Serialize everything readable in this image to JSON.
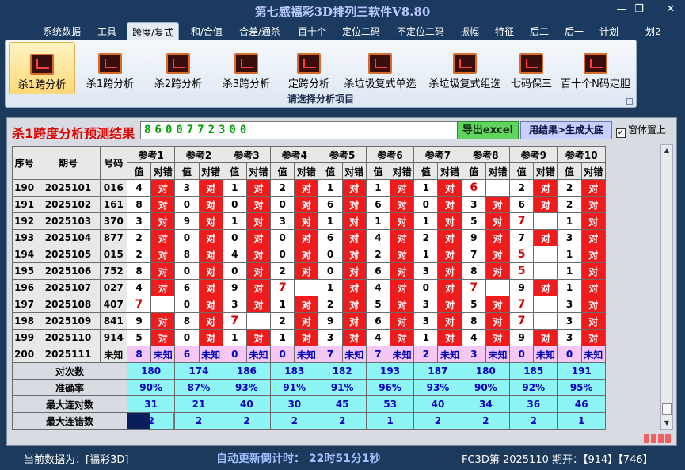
{
  "window": {
    "title": "第七感福彩3D排列三软件V8.80",
    "minimize": "—",
    "restore": "❐",
    "close": "✕"
  },
  "menu": [
    "系统数据",
    "工具",
    "跨度/复式",
    "和/合值",
    "合差/通杀",
    "百十个",
    "定位二码",
    "不定位二码",
    "振幅",
    "特征",
    "后二",
    "后一",
    "计划",
    "划2"
  ],
  "menu_active_index": 2,
  "ribbon": {
    "buttons": [
      "杀1跨分析",
      "杀1跨分析",
      "杀2跨分析",
      "杀3跨分析",
      "定跨分析",
      "杀垃圾复式单选",
      "杀垃圾复式组选",
      "七码保三",
      "百十个N码定胆"
    ],
    "selected_index": 0,
    "group_label": "请选择分析项目"
  },
  "result": {
    "label": "杀1跨度分析预测结果",
    "value": "8600772300",
    "excel_button": "导出excel",
    "generate_button": "用结果>生成大底",
    "pin_label": "窗体置上",
    "pin_checked": true
  },
  "table": {
    "col_no": "序号",
    "col_period": "期号",
    "col_code": "号码",
    "refs": [
      "参考1",
      "参考2",
      "参考3",
      "参考4",
      "参考5",
      "参考6",
      "参考7",
      "参考8",
      "参考9",
      "参考10"
    ],
    "sub_value": "值",
    "sub_result": "对错",
    "ok_text": "对",
    "rows": [
      {
        "no": "190",
        "period": "2025101",
        "code": "016",
        "cells": [
          [
            "4",
            "对"
          ],
          [
            "3",
            "对"
          ],
          [
            "1",
            "对"
          ],
          [
            "2",
            "对"
          ],
          [
            "1",
            "对"
          ],
          [
            "1",
            "对"
          ],
          [
            "1",
            "对"
          ],
          [
            "6",
            ""
          ],
          [
            "2",
            "对"
          ],
          [
            "2",
            "对"
          ]
        ],
        "hl": [
          7
        ]
      },
      {
        "no": "191",
        "period": "2025102",
        "code": "161",
        "cells": [
          [
            "8",
            "对"
          ],
          [
            "0",
            "对"
          ],
          [
            "0",
            "对"
          ],
          [
            "0",
            "对"
          ],
          [
            "6",
            "对"
          ],
          [
            "6",
            "对"
          ],
          [
            "0",
            "对"
          ],
          [
            "3",
            "对"
          ],
          [
            "6",
            "对"
          ],
          [
            "2",
            "对"
          ]
        ],
        "hl": []
      },
      {
        "no": "192",
        "period": "2025103",
        "code": "370",
        "cells": [
          [
            "3",
            "对"
          ],
          [
            "9",
            "对"
          ],
          [
            "1",
            "对"
          ],
          [
            "3",
            "对"
          ],
          [
            "1",
            "对"
          ],
          [
            "1",
            "对"
          ],
          [
            "1",
            "对"
          ],
          [
            "5",
            "对"
          ],
          [
            "7",
            ""
          ],
          [
            "1",
            "对"
          ]
        ],
        "hl": [
          8
        ]
      },
      {
        "no": "193",
        "period": "2025104",
        "code": "877",
        "cells": [
          [
            "2",
            "对"
          ],
          [
            "0",
            "对"
          ],
          [
            "0",
            "对"
          ],
          [
            "0",
            "对"
          ],
          [
            "6",
            "对"
          ],
          [
            "4",
            "对"
          ],
          [
            "2",
            "对"
          ],
          [
            "9",
            "对"
          ],
          [
            "7",
            "对"
          ],
          [
            "3",
            "对"
          ]
        ],
        "hl": []
      },
      {
        "no": "194",
        "period": "2025105",
        "code": "015",
        "cells": [
          [
            "2",
            "对"
          ],
          [
            "8",
            "对"
          ],
          [
            "4",
            "对"
          ],
          [
            "0",
            "对"
          ],
          [
            "0",
            "对"
          ],
          [
            "2",
            "对"
          ],
          [
            "1",
            "对"
          ],
          [
            "7",
            "对"
          ],
          [
            "5",
            ""
          ],
          [
            "1",
            "对"
          ]
        ],
        "hl": [
          8
        ]
      },
      {
        "no": "195",
        "period": "2025106",
        "code": "752",
        "cells": [
          [
            "8",
            "对"
          ],
          [
            "0",
            "对"
          ],
          [
            "0",
            "对"
          ],
          [
            "2",
            "对"
          ],
          [
            "0",
            "对"
          ],
          [
            "6",
            "对"
          ],
          [
            "3",
            "对"
          ],
          [
            "8",
            "对"
          ],
          [
            "5",
            ""
          ],
          [
            "1",
            "对"
          ]
        ],
        "hl": [
          8
        ]
      },
      {
        "no": "196",
        "period": "2025107",
        "code": "027",
        "cells": [
          [
            "4",
            "对"
          ],
          [
            "6",
            "对"
          ],
          [
            "9",
            "对"
          ],
          [
            "7",
            ""
          ],
          [
            "1",
            "对"
          ],
          [
            "4",
            "对"
          ],
          [
            "0",
            "对"
          ],
          [
            "7",
            ""
          ],
          [
            "9",
            "对"
          ],
          [
            "1",
            "对"
          ]
        ],
        "hl": [
          3,
          7
        ]
      },
      {
        "no": "197",
        "period": "2025108",
        "code": "407",
        "cells": [
          [
            "7",
            ""
          ],
          [
            "0",
            "对"
          ],
          [
            "3",
            "对"
          ],
          [
            "1",
            "对"
          ],
          [
            "2",
            "对"
          ],
          [
            "5",
            "对"
          ],
          [
            "3",
            "对"
          ],
          [
            "5",
            "对"
          ],
          [
            "7",
            ""
          ],
          [
            "3",
            "对"
          ]
        ],
        "hl": [
          0,
          8
        ]
      },
      {
        "no": "198",
        "period": "2025109",
        "code": "841",
        "cells": [
          [
            "9",
            "对"
          ],
          [
            "8",
            "对"
          ],
          [
            "7",
            ""
          ],
          [
            "2",
            "对"
          ],
          [
            "9",
            "对"
          ],
          [
            "6",
            "对"
          ],
          [
            "3",
            "对"
          ],
          [
            "8",
            "对"
          ],
          [
            "7",
            ""
          ],
          [
            "3",
            "对"
          ]
        ],
        "hl": [
          2,
          8
        ]
      },
      {
        "no": "199",
        "period": "2025110",
        "code": "914",
        "cells": [
          [
            "5",
            "对"
          ],
          [
            "0",
            "对"
          ],
          [
            "1",
            "对"
          ],
          [
            "1",
            "对"
          ],
          [
            "3",
            "对"
          ],
          [
            "4",
            "对"
          ],
          [
            "1",
            "对"
          ],
          [
            "4",
            "对"
          ],
          [
            "9",
            "对"
          ],
          [
            "3",
            "对"
          ]
        ],
        "hl": []
      },
      {
        "no": "200",
        "period": "2025111",
        "code": "未知",
        "cells": [
          [
            "8",
            "未知"
          ],
          [
            "6",
            "未知"
          ],
          [
            "0",
            "未知"
          ],
          [
            "0",
            "未知"
          ],
          [
            "7",
            "未知"
          ],
          [
            "7",
            "未知"
          ],
          [
            "2",
            "未知"
          ],
          [
            "3",
            "未知"
          ],
          [
            "0",
            "未知"
          ],
          [
            "0",
            "未知"
          ]
        ],
        "hl": [],
        "unknown": true
      }
    ],
    "stats": [
      {
        "label": "对次数",
        "values": [
          "180",
          "174",
          "186",
          "183",
          "182",
          "193",
          "187",
          "180",
          "185",
          "191"
        ]
      },
      {
        "label": "准确率",
        "values": [
          "90%",
          "87%",
          "93%",
          "91%",
          "91%",
          "96%",
          "93%",
          "90%",
          "92%",
          "95%"
        ]
      },
      {
        "label": "最大连对数",
        "values": [
          "31",
          "21",
          "40",
          "30",
          "45",
          "53",
          "40",
          "34",
          "36",
          "46"
        ]
      },
      {
        "label": "最大连错数",
        "values": [
          "2",
          "2",
          "2",
          "2",
          "2",
          "1",
          "2",
          "2",
          "2",
          "1"
        ]
      }
    ]
  },
  "status": {
    "current_data": "当前数据为：[福彩3D]",
    "countdown": "自动更新倒计时： 22时51分1秒",
    "latest": "FC3D第 2025110 期开：【914】【746】"
  }
}
